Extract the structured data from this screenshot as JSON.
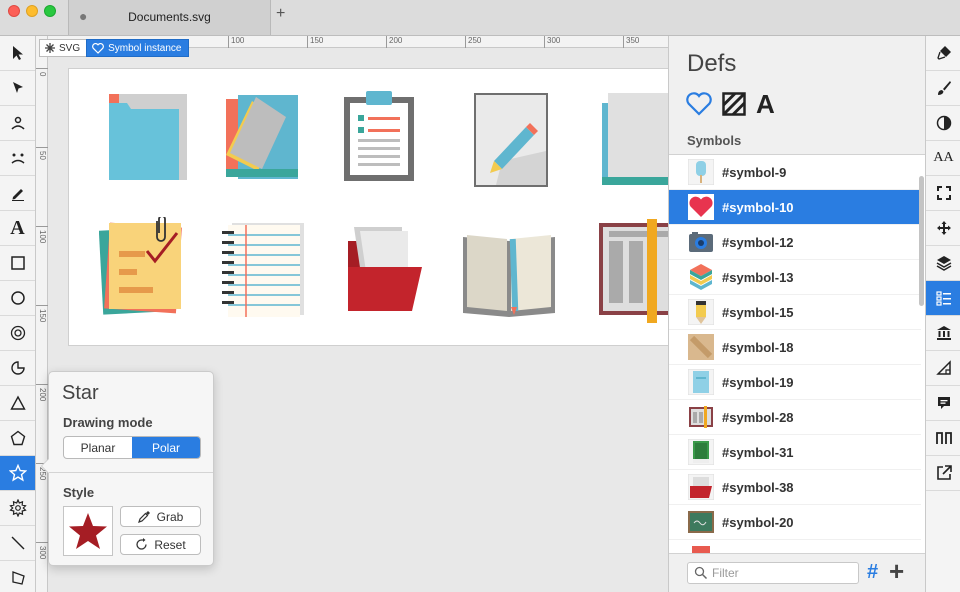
{
  "window": {
    "tab_title": "Documents.svg",
    "new_tab_label": "+"
  },
  "rulers": {
    "horizontal_labels": [
      "100",
      "150",
      "200",
      "250",
      "300",
      "350"
    ],
    "vertical_labels": [
      "0",
      "50",
      "100",
      "150",
      "200",
      "250",
      "300"
    ]
  },
  "breadcrumb": {
    "root_label": "SVG",
    "current_label": "Symbol instance"
  },
  "left_toolbar": {
    "tools": [
      "arrow-select-icon",
      "node-select-icon",
      "view-icon",
      "face-icon",
      "pencil-icon",
      "text-icon",
      "rectangle-icon",
      "circle-icon",
      "ring-icon",
      "pie-icon",
      "triangle-icon",
      "pentagon-icon",
      "star-icon",
      "cog-icon",
      "line-icon",
      "freeform-icon"
    ],
    "active_tool": "star-icon",
    "text_tool_glyph": "A"
  },
  "star_popover": {
    "title": "Star",
    "drawing_mode_label": "Drawing mode",
    "modes": [
      "Planar",
      "Polar"
    ],
    "selected_mode": "Polar",
    "style_label": "Style",
    "grab_label": "Grab",
    "reset_label": "Reset",
    "swatch_color": "#a51d24"
  },
  "defs_panel": {
    "title": "Defs",
    "type_icons": [
      "heart-icon",
      "pattern-icon",
      "font-icon"
    ],
    "font_glyph": "A",
    "section_label": "Symbols",
    "symbols": [
      "#symbol-9",
      "#symbol-10",
      "#symbol-12",
      "#symbol-13",
      "#symbol-15",
      "#symbol-18",
      "#symbol-19",
      "#symbol-28",
      "#symbol-31",
      "#symbol-38",
      "#symbol-20"
    ],
    "selected_symbol": "#symbol-10",
    "filter_placeholder": "Filter",
    "hash_label": "#",
    "add_label": "+"
  },
  "right_toolbar": {
    "tools": [
      "brush-fill-icon",
      "paintbrush-icon",
      "contrast-icon",
      "font-size-icon",
      "fullscreen-icon",
      "move-icon",
      "layers-icon",
      "list-icon",
      "bank-icon",
      "ruler-icon",
      "comment-icon",
      "wave-icon",
      "export-icon"
    ],
    "active_tool": "list-icon",
    "font_size_glyph": "AA"
  },
  "colors": {
    "accent": "#2a7de1",
    "selected_row": "#2a7de1",
    "star_fill": "#a51d24"
  }
}
